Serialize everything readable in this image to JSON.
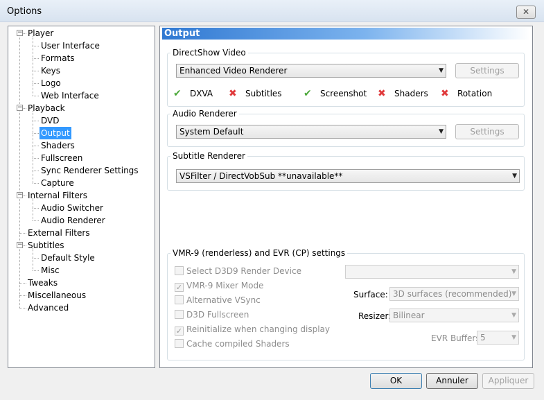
{
  "window": {
    "title": "Options",
    "close_glyph": "✕"
  },
  "tree": {
    "items": [
      {
        "label": "Player",
        "level": 0,
        "expander": "−"
      },
      {
        "label": "User Interface",
        "level": 1
      },
      {
        "label": "Formats",
        "level": 1
      },
      {
        "label": "Keys",
        "level": 1
      },
      {
        "label": "Logo",
        "level": 1
      },
      {
        "label": "Web Interface",
        "level": 1
      },
      {
        "label": "Playback",
        "level": 0,
        "expander": "−"
      },
      {
        "label": "DVD",
        "level": 1
      },
      {
        "label": "Output",
        "level": 1,
        "selected": true
      },
      {
        "label": "Shaders",
        "level": 1
      },
      {
        "label": "Fullscreen",
        "level": 1
      },
      {
        "label": "Sync Renderer Settings",
        "level": 1
      },
      {
        "label": "Capture",
        "level": 1
      },
      {
        "label": "Internal Filters",
        "level": 0,
        "expander": "−"
      },
      {
        "label": "Audio Switcher",
        "level": 1
      },
      {
        "label": "Audio Renderer",
        "level": 1
      },
      {
        "label": "External Filters",
        "level": 0
      },
      {
        "label": "Subtitles",
        "level": 0,
        "expander": "−"
      },
      {
        "label": "Default Style",
        "level": 1
      },
      {
        "label": "Misc",
        "level": 1
      },
      {
        "label": "Tweaks",
        "level": 0
      },
      {
        "label": "Miscellaneous",
        "level": 0
      },
      {
        "label": "Advanced",
        "level": 0
      }
    ]
  },
  "output": {
    "title": "Output",
    "directshow": {
      "group_title": "DirectShow Video",
      "renderer": "Enhanced Video Renderer",
      "settings_label": "Settings",
      "caps": [
        {
          "label": "DXVA",
          "ok": true,
          "glyph": "✔"
        },
        {
          "label": "Subtitles",
          "ok": false,
          "glyph": "✖"
        },
        {
          "label": "Screenshot",
          "ok": true,
          "glyph": "✔"
        },
        {
          "label": "Shaders",
          "ok": false,
          "glyph": "✖"
        },
        {
          "label": "Rotation",
          "ok": false,
          "glyph": "✖"
        }
      ]
    },
    "audio": {
      "group_title": "Audio Renderer",
      "renderer": "System Default",
      "settings_label": "Settings"
    },
    "subtitle": {
      "group_title": "Subtitle Renderer",
      "renderer": "VSFilter / DirectVobSub   **unavailable**"
    },
    "vmr": {
      "group_title": "VMR-9 (renderless) and EVR (CP) settings",
      "checkboxes": [
        {
          "label": "Select D3D9 Render Device",
          "checked": false
        },
        {
          "label": "VMR-9 Mixer Mode",
          "checked": true
        },
        {
          "label": "Alternative VSync",
          "checked": false
        },
        {
          "label": "D3D Fullscreen",
          "checked": false
        },
        {
          "label": "Reinitialize when changing display",
          "checked": true
        },
        {
          "label": "Cache compiled Shaders",
          "checked": false
        }
      ],
      "device_value": "",
      "surface_label": "Surface:",
      "surface_value": "3D surfaces (recommended)",
      "resizer_label": "Resizer:",
      "resizer_value": "Bilinear",
      "evr_buffers_label": "EVR Buffers:",
      "evr_buffers_value": "5"
    }
  },
  "footer": {
    "ok": "OK",
    "cancel": "Annuler",
    "apply": "Appliquer"
  },
  "colors": {
    "selection": "#3399ff",
    "ok_icon": "#4ca83a",
    "no_icon": "#e0393b"
  }
}
